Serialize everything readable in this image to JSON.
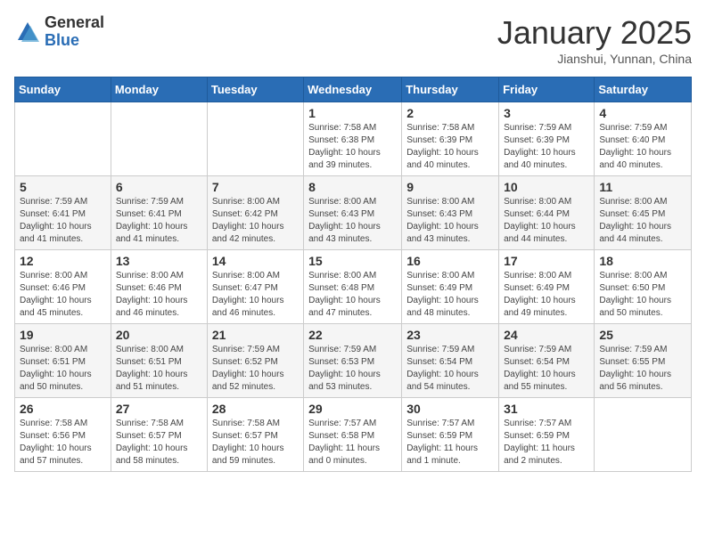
{
  "logo": {
    "general": "General",
    "blue": "Blue"
  },
  "header": {
    "month": "January 2025",
    "location": "Jianshui, Yunnan, China"
  },
  "weekdays": [
    "Sunday",
    "Monday",
    "Tuesday",
    "Wednesday",
    "Thursday",
    "Friday",
    "Saturday"
  ],
  "weeks": [
    [
      {
        "day": "",
        "info": ""
      },
      {
        "day": "",
        "info": ""
      },
      {
        "day": "",
        "info": ""
      },
      {
        "day": "1",
        "info": "Sunrise: 7:58 AM\nSunset: 6:38 PM\nDaylight: 10 hours\nand 39 minutes."
      },
      {
        "day": "2",
        "info": "Sunrise: 7:58 AM\nSunset: 6:39 PM\nDaylight: 10 hours\nand 40 minutes."
      },
      {
        "day": "3",
        "info": "Sunrise: 7:59 AM\nSunset: 6:39 PM\nDaylight: 10 hours\nand 40 minutes."
      },
      {
        "day": "4",
        "info": "Sunrise: 7:59 AM\nSunset: 6:40 PM\nDaylight: 10 hours\nand 40 minutes."
      }
    ],
    [
      {
        "day": "5",
        "info": "Sunrise: 7:59 AM\nSunset: 6:41 PM\nDaylight: 10 hours\nand 41 minutes."
      },
      {
        "day": "6",
        "info": "Sunrise: 7:59 AM\nSunset: 6:41 PM\nDaylight: 10 hours\nand 41 minutes."
      },
      {
        "day": "7",
        "info": "Sunrise: 8:00 AM\nSunset: 6:42 PM\nDaylight: 10 hours\nand 42 minutes."
      },
      {
        "day": "8",
        "info": "Sunrise: 8:00 AM\nSunset: 6:43 PM\nDaylight: 10 hours\nand 43 minutes."
      },
      {
        "day": "9",
        "info": "Sunrise: 8:00 AM\nSunset: 6:43 PM\nDaylight: 10 hours\nand 43 minutes."
      },
      {
        "day": "10",
        "info": "Sunrise: 8:00 AM\nSunset: 6:44 PM\nDaylight: 10 hours\nand 44 minutes."
      },
      {
        "day": "11",
        "info": "Sunrise: 8:00 AM\nSunset: 6:45 PM\nDaylight: 10 hours\nand 44 minutes."
      }
    ],
    [
      {
        "day": "12",
        "info": "Sunrise: 8:00 AM\nSunset: 6:46 PM\nDaylight: 10 hours\nand 45 minutes."
      },
      {
        "day": "13",
        "info": "Sunrise: 8:00 AM\nSunset: 6:46 PM\nDaylight: 10 hours\nand 46 minutes."
      },
      {
        "day": "14",
        "info": "Sunrise: 8:00 AM\nSunset: 6:47 PM\nDaylight: 10 hours\nand 46 minutes."
      },
      {
        "day": "15",
        "info": "Sunrise: 8:00 AM\nSunset: 6:48 PM\nDaylight: 10 hours\nand 47 minutes."
      },
      {
        "day": "16",
        "info": "Sunrise: 8:00 AM\nSunset: 6:49 PM\nDaylight: 10 hours\nand 48 minutes."
      },
      {
        "day": "17",
        "info": "Sunrise: 8:00 AM\nSunset: 6:49 PM\nDaylight: 10 hours\nand 49 minutes."
      },
      {
        "day": "18",
        "info": "Sunrise: 8:00 AM\nSunset: 6:50 PM\nDaylight: 10 hours\nand 50 minutes."
      }
    ],
    [
      {
        "day": "19",
        "info": "Sunrise: 8:00 AM\nSunset: 6:51 PM\nDaylight: 10 hours\nand 50 minutes."
      },
      {
        "day": "20",
        "info": "Sunrise: 8:00 AM\nSunset: 6:51 PM\nDaylight: 10 hours\nand 51 minutes."
      },
      {
        "day": "21",
        "info": "Sunrise: 7:59 AM\nSunset: 6:52 PM\nDaylight: 10 hours\nand 52 minutes."
      },
      {
        "day": "22",
        "info": "Sunrise: 7:59 AM\nSunset: 6:53 PM\nDaylight: 10 hours\nand 53 minutes."
      },
      {
        "day": "23",
        "info": "Sunrise: 7:59 AM\nSunset: 6:54 PM\nDaylight: 10 hours\nand 54 minutes."
      },
      {
        "day": "24",
        "info": "Sunrise: 7:59 AM\nSunset: 6:54 PM\nDaylight: 10 hours\nand 55 minutes."
      },
      {
        "day": "25",
        "info": "Sunrise: 7:59 AM\nSunset: 6:55 PM\nDaylight: 10 hours\nand 56 minutes."
      }
    ],
    [
      {
        "day": "26",
        "info": "Sunrise: 7:58 AM\nSunset: 6:56 PM\nDaylight: 10 hours\nand 57 minutes."
      },
      {
        "day": "27",
        "info": "Sunrise: 7:58 AM\nSunset: 6:57 PM\nDaylight: 10 hours\nand 58 minutes."
      },
      {
        "day": "28",
        "info": "Sunrise: 7:58 AM\nSunset: 6:57 PM\nDaylight: 10 hours\nand 59 minutes."
      },
      {
        "day": "29",
        "info": "Sunrise: 7:57 AM\nSunset: 6:58 PM\nDaylight: 11 hours\nand 0 minutes."
      },
      {
        "day": "30",
        "info": "Sunrise: 7:57 AM\nSunset: 6:59 PM\nDaylight: 11 hours\nand 1 minute."
      },
      {
        "day": "31",
        "info": "Sunrise: 7:57 AM\nSunset: 6:59 PM\nDaylight: 11 hours\nand 2 minutes."
      },
      {
        "day": "",
        "info": ""
      }
    ]
  ]
}
